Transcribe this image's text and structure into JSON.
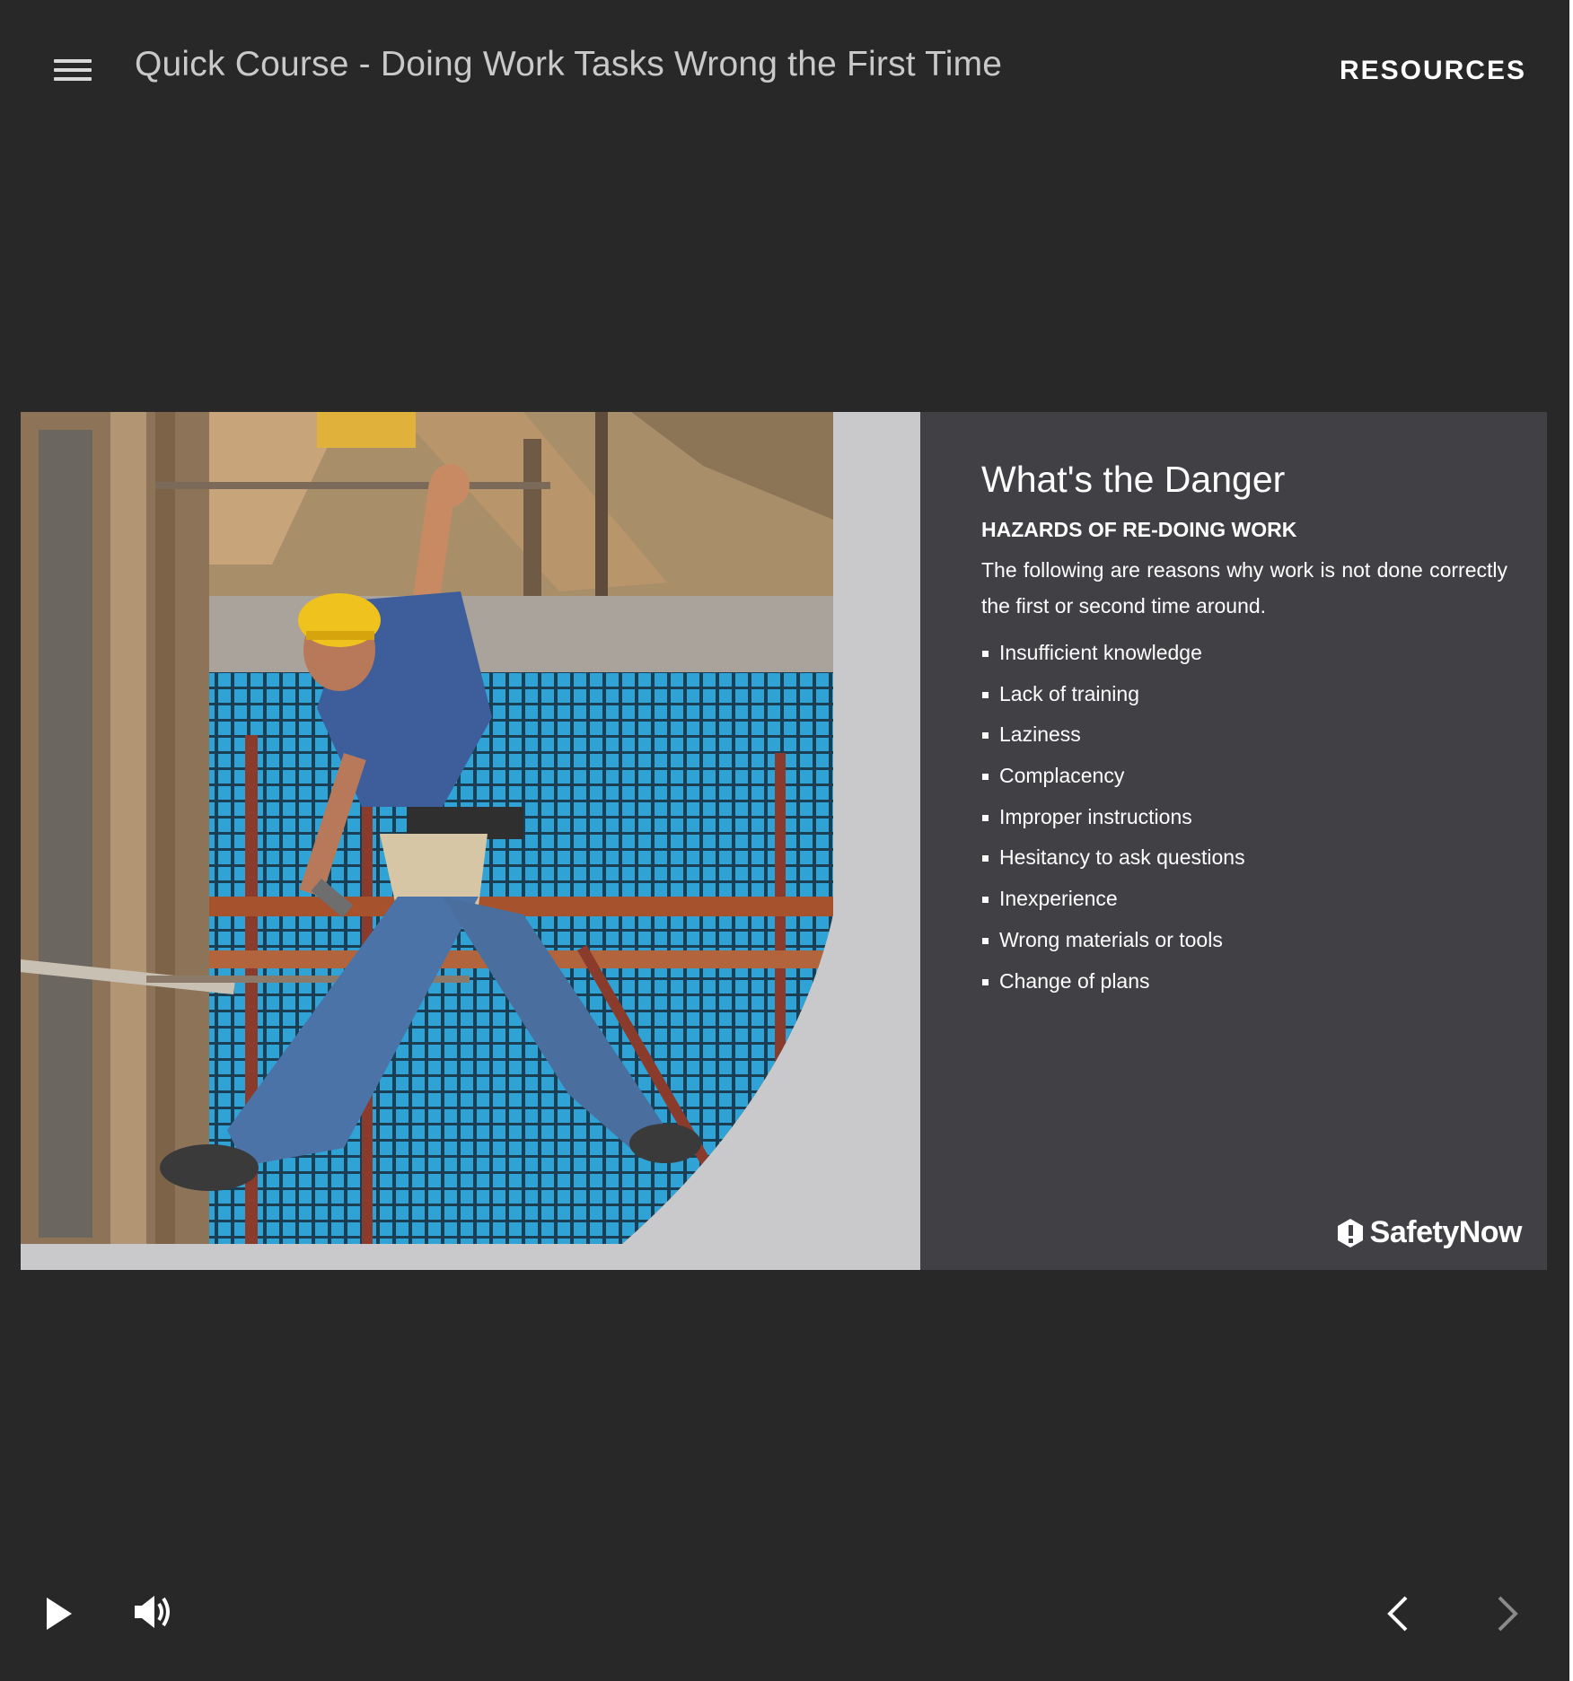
{
  "header": {
    "course_title": "Quick Course - Doing Work Tasks Wrong the First Time",
    "resources_label": "RESOURCES",
    "menu_icon": "hamburger-menu-icon"
  },
  "slide": {
    "heading": "What's the Danger",
    "subheading": "HAZARDS OF RE-DOING WORK",
    "intro": "The following are reasons why work is not done correctly the first or second time around.",
    "reasons": [
      "Insufficient knowledge",
      "Lack of training",
      "Laziness",
      "Complacency",
      "Improper instructions",
      "Hesitancy to ask questions",
      "Inexperience",
      "Wrong materials or tools",
      "Change of plans"
    ],
    "brand": "SafetyNow",
    "photo": "construction-worker-on-scaffolding-photo"
  },
  "controls": {
    "play_icon": "play-icon",
    "volume_icon": "volume-icon",
    "prev_icon": "chevron-left-icon",
    "next_icon": "chevron-right-icon"
  },
  "colors": {
    "background": "#282829",
    "panel": "#414045",
    "slide_gray": "#c9c9cb",
    "title_text": "#c9c9c9",
    "white": "#ffffff"
  }
}
